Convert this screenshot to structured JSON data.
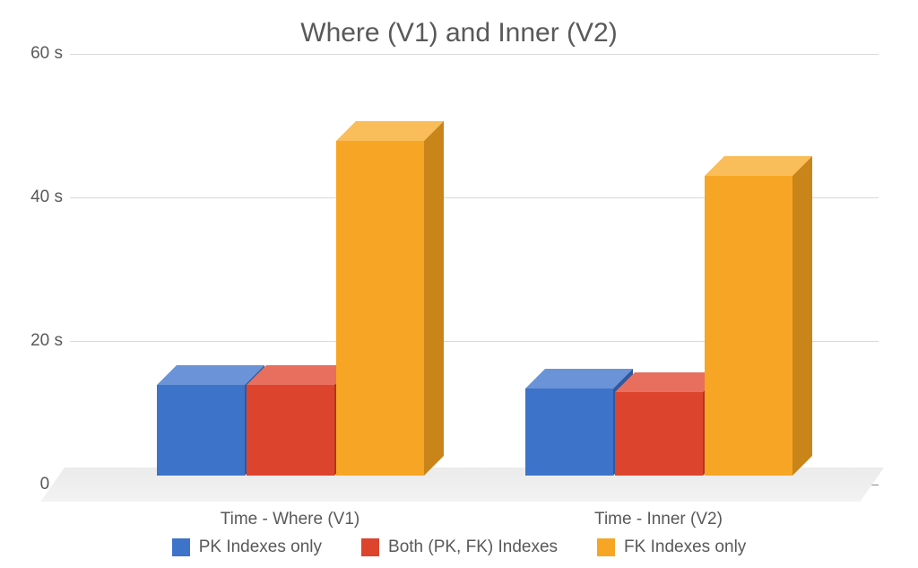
{
  "chart_data": {
    "type": "bar",
    "title": "Where (V1) and Inner (V2)",
    "ylim": [
      0,
      60
    ],
    "y_tick_suffix": " s",
    "y_ticks": [
      0,
      20,
      40,
      60
    ],
    "categories": [
      "Time - Where (V1)",
      "Time - Inner (V2)"
    ],
    "series": [
      {
        "name": "PK Indexes only",
        "color": "#3e73ca",
        "values": [
          13,
          12.5
        ]
      },
      {
        "name": "Both (PK, FK) Indexes",
        "color": "#dd442d",
        "values": [
          13,
          12
        ]
      },
      {
        "name": "FK Indexes only",
        "color": "#f6a624",
        "values": [
          48,
          43
        ]
      }
    ],
    "xlabel": "",
    "ylabel": ""
  }
}
